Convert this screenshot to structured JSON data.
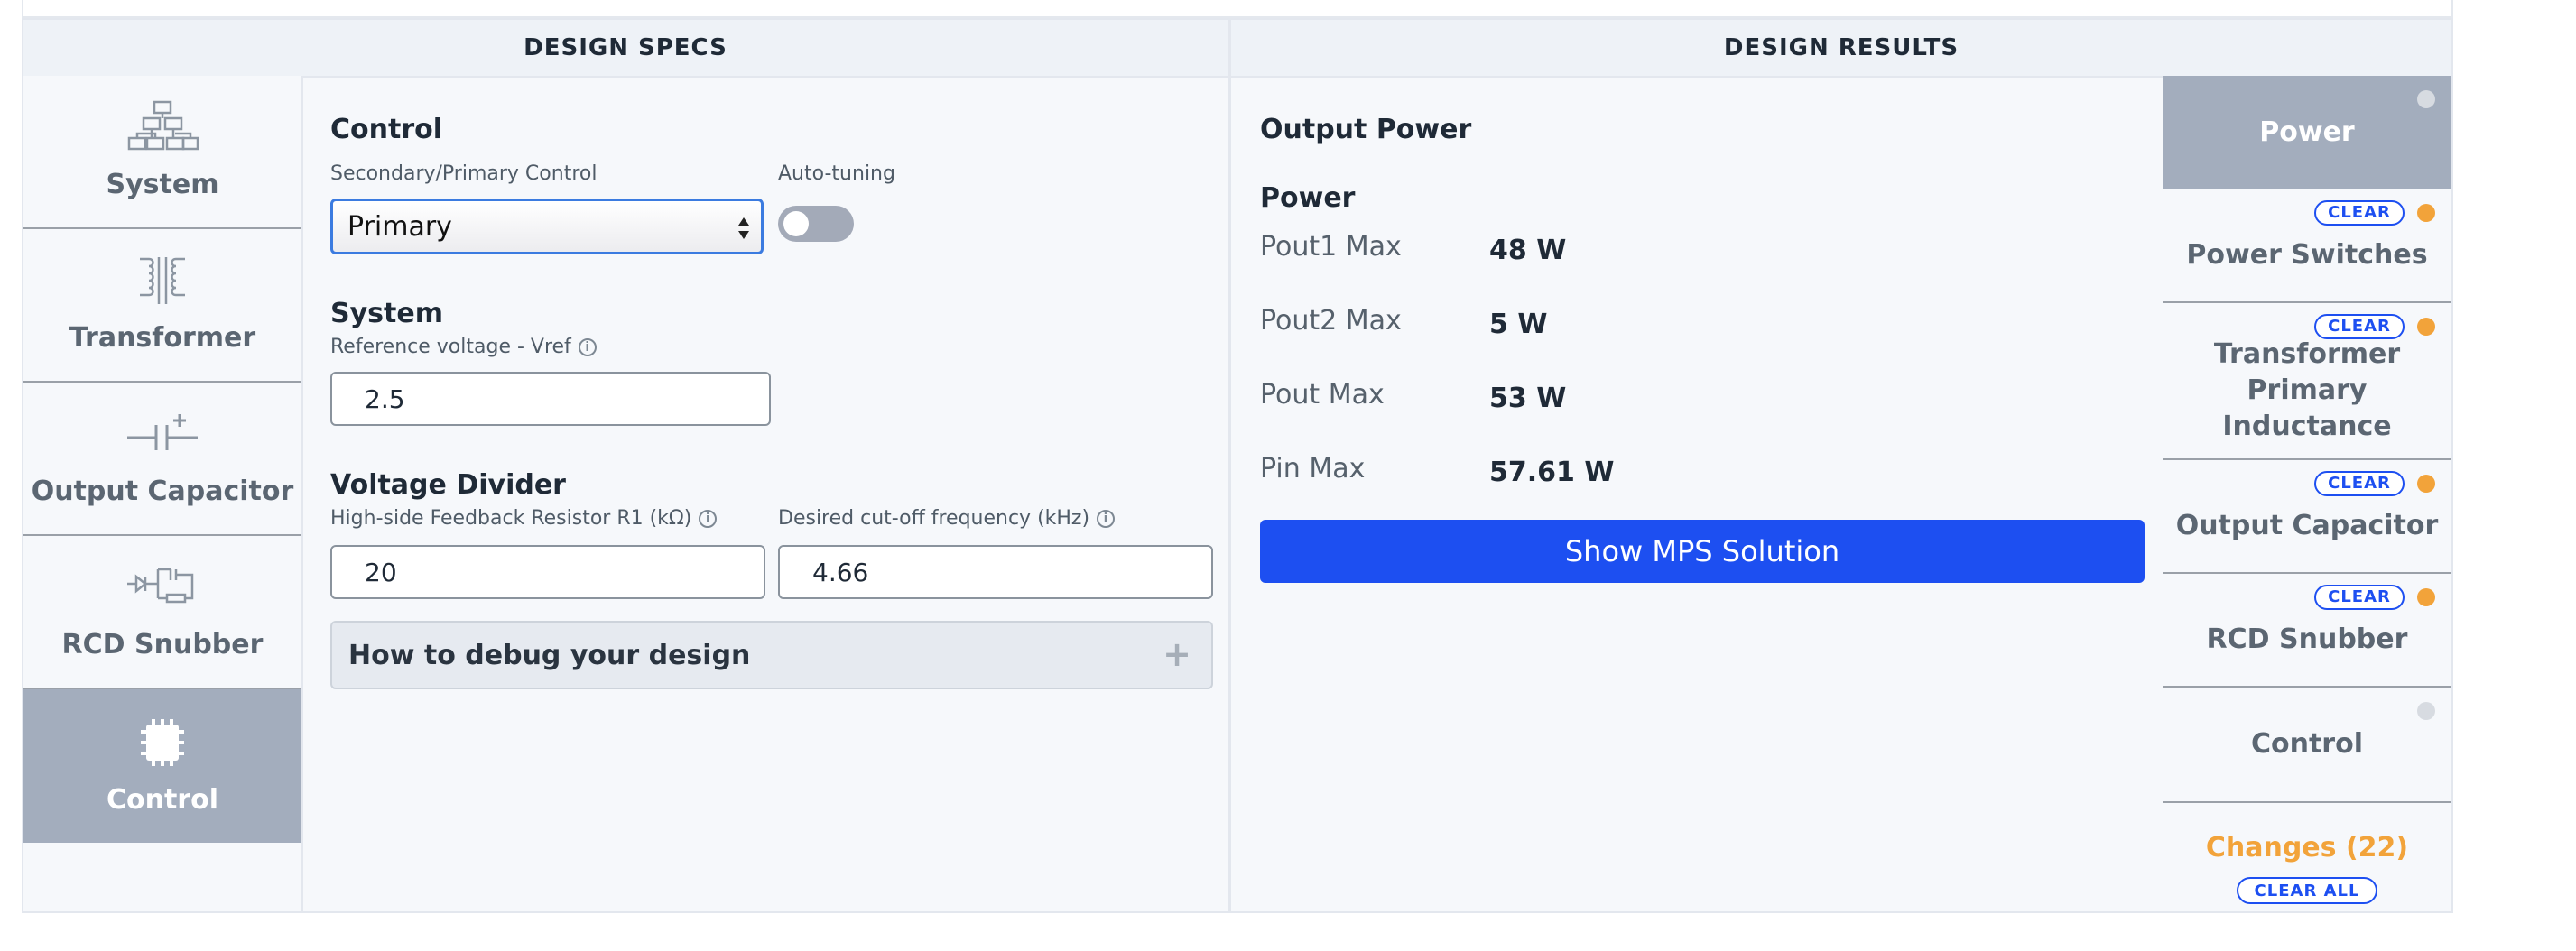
{
  "specs": {
    "header": "DESIGN SPECS",
    "nav": [
      {
        "label": "System",
        "icon": "system-hierarchy-icon"
      },
      {
        "label": "Transformer",
        "icon": "transformer-icon"
      },
      {
        "label": "Output Capacitor",
        "icon": "capacitor-icon"
      },
      {
        "label": "RCD Snubber",
        "icon": "rcd-snubber-icon"
      },
      {
        "label": "Control",
        "icon": "chip-icon",
        "active": true
      }
    ],
    "control": {
      "title": "Control",
      "mode_label": "Secondary/Primary Control",
      "mode_value": "Primary",
      "autotune_label": "Auto-tuning",
      "autotune_on": false
    },
    "system": {
      "title": "System",
      "vref_label": "Reference voltage - Vref",
      "vref_value": "2.5"
    },
    "divider": {
      "title": "Voltage Divider",
      "r1_label": "High-side Feedback Resistor R1 (kΩ)",
      "r1_value": "20",
      "fc_label": "Desired cut-off frequency (kHz)",
      "fc_value": "4.66"
    },
    "debug_label": "How to debug your design",
    "debug_expand": "+"
  },
  "results": {
    "header": "DESIGN RESULTS",
    "section": "Output Power",
    "subsection": "Power",
    "rows": [
      {
        "label": "Pout1 Max",
        "value": "48 W"
      },
      {
        "label": "Pout2 Max",
        "value": "5 W"
      },
      {
        "label": "Pout Max",
        "value": "53 W"
      },
      {
        "label": "Pin Max",
        "value": "57.61 W"
      }
    ],
    "mps_button": "Show MPS Solution",
    "tabs": [
      {
        "label": "Power",
        "status": "gray",
        "clear": false,
        "active": true
      },
      {
        "label": "Power Switches",
        "status": "orange",
        "clear": true
      },
      {
        "label": "Transformer Primary Inductance",
        "status": "orange",
        "clear": true
      },
      {
        "label": "Output Capacitor",
        "status": "orange",
        "clear": true
      },
      {
        "label": "RCD Snubber",
        "status": "orange",
        "clear": true
      },
      {
        "label": "Control",
        "status": "gray",
        "clear": false
      }
    ],
    "clear_label": "CLEAR",
    "changes_label": "Changes (22)",
    "clear_all_label": "CLEAR ALL"
  },
  "colors": {
    "accent": "#1d4ff1",
    "changed": "#f2a33a",
    "active_tab": "#a3adbd"
  }
}
